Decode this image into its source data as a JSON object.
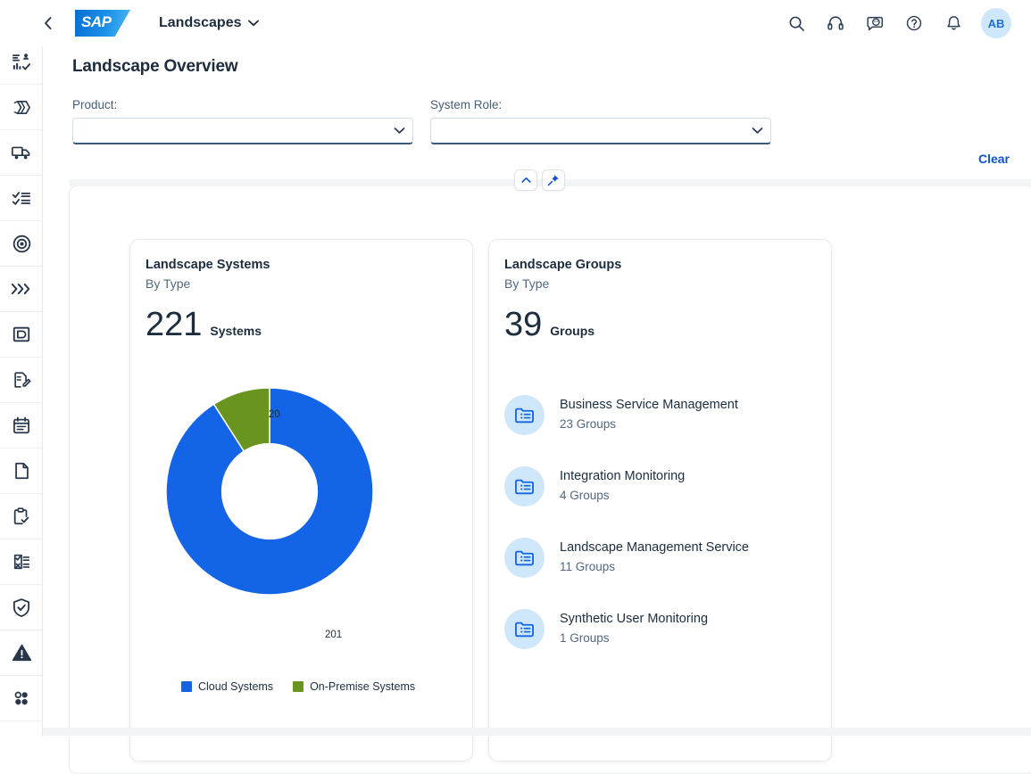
{
  "topbar": {
    "back_icon": "chevron-left-icon",
    "logo_text": "SAP",
    "app_title": "Landscapes",
    "chevron_icon": "chevron-down-icon",
    "icons": [
      "search-icon",
      "headset-support-icon",
      "chat-feedback-icon",
      "help-question-icon",
      "notification-bell-icon"
    ],
    "avatar_initials": "AB"
  },
  "sidebar": {
    "items": [
      {
        "name": "analytics-users-icon"
      },
      {
        "name": "layers-package-icon"
      },
      {
        "name": "delivery-truck-icon"
      },
      {
        "name": "checklist-icon"
      },
      {
        "name": "target-icon"
      },
      {
        "name": "chevrons-right-icon"
      },
      {
        "name": "flow-box-icon"
      },
      {
        "name": "edit-document-icon"
      },
      {
        "name": "calendar-notes-icon"
      },
      {
        "name": "page-icon"
      },
      {
        "name": "clipboard-check-icon"
      },
      {
        "name": "form-xcheck-icon"
      },
      {
        "name": "shield-check-icon"
      },
      {
        "name": "alert-warning-icon"
      },
      {
        "name": "four-dots-icon"
      }
    ]
  },
  "page": {
    "title": "Landscape Overview"
  },
  "filters": {
    "product": {
      "label": "Product:",
      "value": "",
      "placeholder": ""
    },
    "system_role": {
      "label": "System Role:",
      "value": "",
      "placeholder": ""
    },
    "clear_label": "Clear",
    "collapse_icon": "chevron-up-icon",
    "pin_icon": "pin-icon"
  },
  "cards": {
    "systems": {
      "title": "Landscape Systems",
      "subtitle": "By Type",
      "kpi_value": "221",
      "kpi_unit": "Systems"
    },
    "groups": {
      "title": "Landscape Groups",
      "subtitle": "By Type",
      "kpi_value": "39",
      "kpi_unit": "Groups",
      "items": [
        {
          "icon": "group-list-icon",
          "name": "Business Service Management",
          "count": "23 Groups"
        },
        {
          "icon": "group-list-icon",
          "name": "Integration Monitoring",
          "count": "4 Groups"
        },
        {
          "icon": "group-list-icon",
          "name": "Landscape Management Service",
          "count": "11 Groups"
        },
        {
          "icon": "group-list-icon",
          "name": "Synthetic User Monitoring",
          "count": "1 Groups"
        }
      ]
    }
  },
  "chart_data": {
    "type": "pie",
    "title": "Landscape Systems By Type",
    "subtype": "donut",
    "categories": [
      "Cloud Systems",
      "On-Premise Systems"
    ],
    "values": [
      201,
      20
    ],
    "colors": [
      "#1464e8",
      "#699420"
    ],
    "data_labels": [
      "201",
      "20"
    ],
    "total": 221,
    "legend_position": "bottom",
    "inner_radius_ratio": 0.46,
    "start_angle_deg": 0
  },
  "colors": {
    "accent_blue": "#0a53d6",
    "chart_blue": "#1464e8",
    "chart_green": "#699420",
    "avatar_bg": "#cfe7fa",
    "text_dark": "#1d2d3e",
    "text_muted": "#53687e"
  }
}
